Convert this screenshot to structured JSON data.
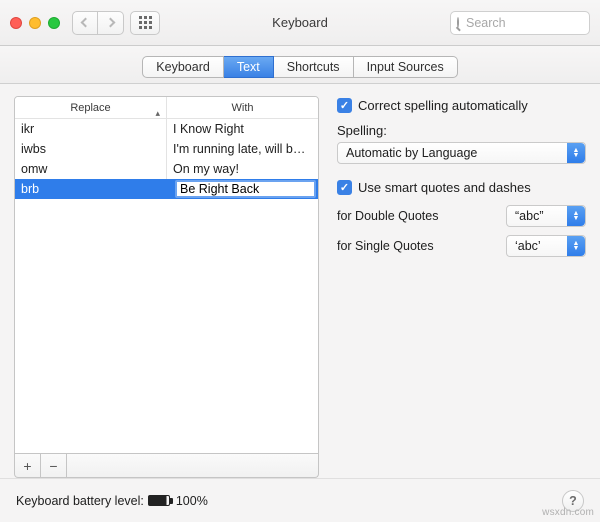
{
  "titlebar": {
    "title": "Keyboard",
    "search_placeholder": "Search"
  },
  "tabs": [
    {
      "label": "Keyboard"
    },
    {
      "label": "Text"
    },
    {
      "label": "Shortcuts"
    },
    {
      "label": "Input Sources"
    }
  ],
  "active_tab_index": 1,
  "replacements": {
    "columns": [
      "Replace",
      "With"
    ],
    "rows": [
      {
        "replace": "ikr",
        "with": "I Know Right"
      },
      {
        "replace": "iwbs",
        "with": "I'm running late, will be the..."
      },
      {
        "replace": "omw",
        "with": "On my way!"
      },
      {
        "replace": "brb",
        "with": "Be Right Back"
      }
    ],
    "selected_index": 3,
    "editing_cell": {
      "row": 3,
      "column": "with"
    }
  },
  "settings": {
    "correct_spelling_label": "Correct spelling automatically",
    "correct_spelling_checked": true,
    "spelling_label": "Spelling:",
    "spelling_value": "Automatic by Language",
    "smart_quotes_label": "Use smart quotes and dashes",
    "smart_quotes_checked": true,
    "double_quotes_label": "for Double Quotes",
    "double_quotes_value": "“abc”",
    "single_quotes_label": "for Single Quotes",
    "single_quotes_value": "‘abc’"
  },
  "footer": {
    "battery_label": "Keyboard battery level:",
    "battery_pct": "100%"
  },
  "watermark": "wsxdn.com"
}
